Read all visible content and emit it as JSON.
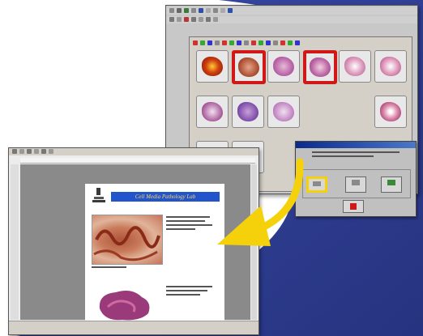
{
  "colors": {
    "navy": "#2f3f9a",
    "accent_red": "#d01818",
    "arrow_yellow": "#f4d10a",
    "highlight": "#f4d10a"
  },
  "back_window": {
    "gallery_thumbnails": [
      {
        "icon": "tissue-icon"
      },
      {
        "icon": "tissue-icon",
        "selected": true
      },
      {
        "icon": "tissue-icon"
      },
      {
        "icon": "tissue-icon",
        "selected": true
      },
      {
        "icon": "tissue-icon"
      },
      {
        "icon": "tissue-icon"
      },
      {
        "icon": "tissue-icon"
      },
      {
        "icon": "tissue-icon"
      },
      {
        "icon": "tissue-icon"
      },
      {
        "icon": "tissue-icon"
      },
      {
        "icon": "tissue-icon"
      },
      {
        "icon": "tissue-icon"
      }
    ]
  },
  "front_window": {
    "page_title": "Cell Media Pathology Lab"
  }
}
